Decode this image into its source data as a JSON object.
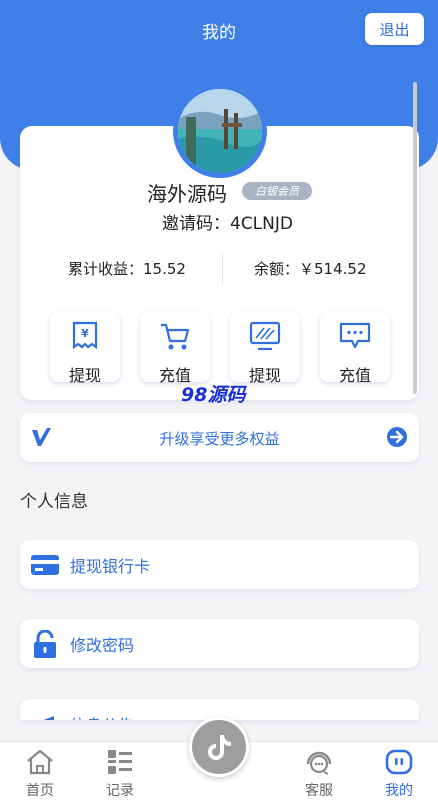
{
  "header": {
    "title": "我的",
    "logout_label": "退出"
  },
  "profile": {
    "username": "海外源码",
    "vip_badge": "白银会员",
    "invite_code": "邀请码：4CLNJD",
    "total_earnings": "累计收益：15.52",
    "balance": "余额：￥514.52"
  },
  "actions": [
    {
      "label": "提现",
      "icon": "withdraw-receipt-icon"
    },
    {
      "label": "充值",
      "icon": "cart-icon"
    },
    {
      "label": "提现",
      "icon": "monitor-icon"
    },
    {
      "label": "充值",
      "icon": "message-icon"
    }
  ],
  "watermark": "98源码",
  "upgrade": {
    "label": "升级享受更多权益"
  },
  "personal_info": {
    "title": "个人信息",
    "items": [
      {
        "label": "提现银行卡",
        "icon": "bank-card-icon"
      },
      {
        "label": "修改密码",
        "icon": "unlock-icon"
      },
      {
        "label": "信息公告",
        "icon": "megaphone-icon"
      }
    ]
  },
  "tabbar": {
    "items": [
      {
        "label": "首页",
        "icon": "home-icon"
      },
      {
        "label": "记录",
        "icon": "list-icon"
      },
      {
        "label": "客服",
        "icon": "service-icon"
      },
      {
        "label": "我的",
        "icon": "profile-icon"
      }
    ],
    "center_icon": "tiktok-icon"
  },
  "colors": {
    "primary": "#3f7fe8",
    "accent_text": "#2f6fe0",
    "background": "#f4f4f6"
  }
}
